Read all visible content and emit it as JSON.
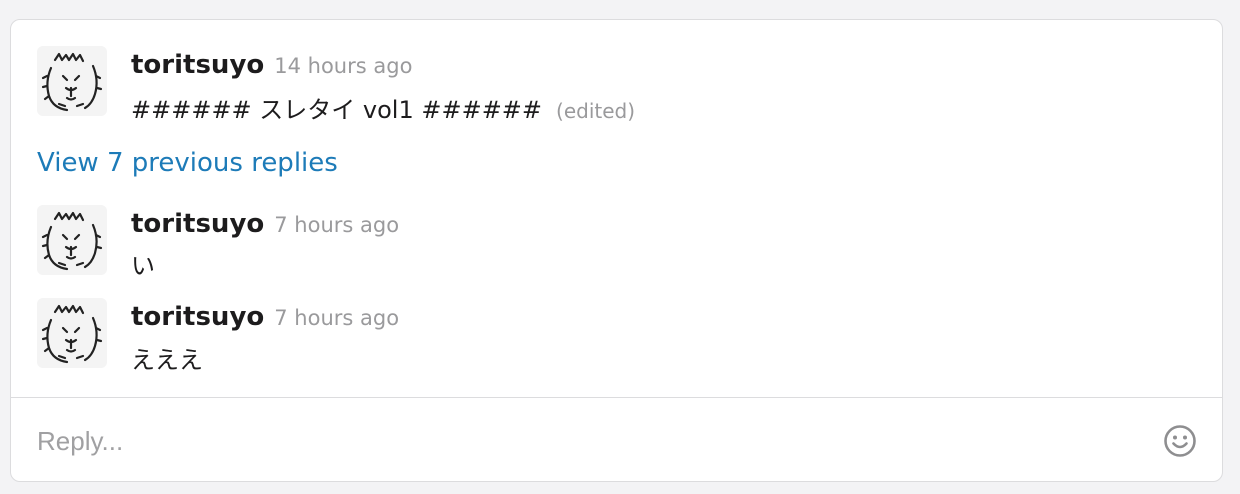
{
  "thread": {
    "parent": {
      "author": "toritsuyo",
      "time": "14 hours ago",
      "text": "###### スレタイ vol1 ######",
      "edited": "(edited)",
      "avatar": "alpaca-sketch-avatar"
    },
    "view_replies_label": "View 7 previous replies",
    "replies": [
      {
        "author": "toritsuyo",
        "time": "7 hours ago",
        "text": "い",
        "avatar": "alpaca-sketch-avatar"
      },
      {
        "author": "toritsuyo",
        "time": "7 hours ago",
        "text": "えええ",
        "avatar": "alpaca-sketch-avatar"
      }
    ]
  },
  "composer": {
    "placeholder": "Reply...",
    "emoji_icon": "smiley-icon"
  },
  "colors": {
    "link": "#1d7bb8",
    "muted": "#9a9a9c",
    "text": "#1d1c1d",
    "border": "#dcdcde"
  }
}
